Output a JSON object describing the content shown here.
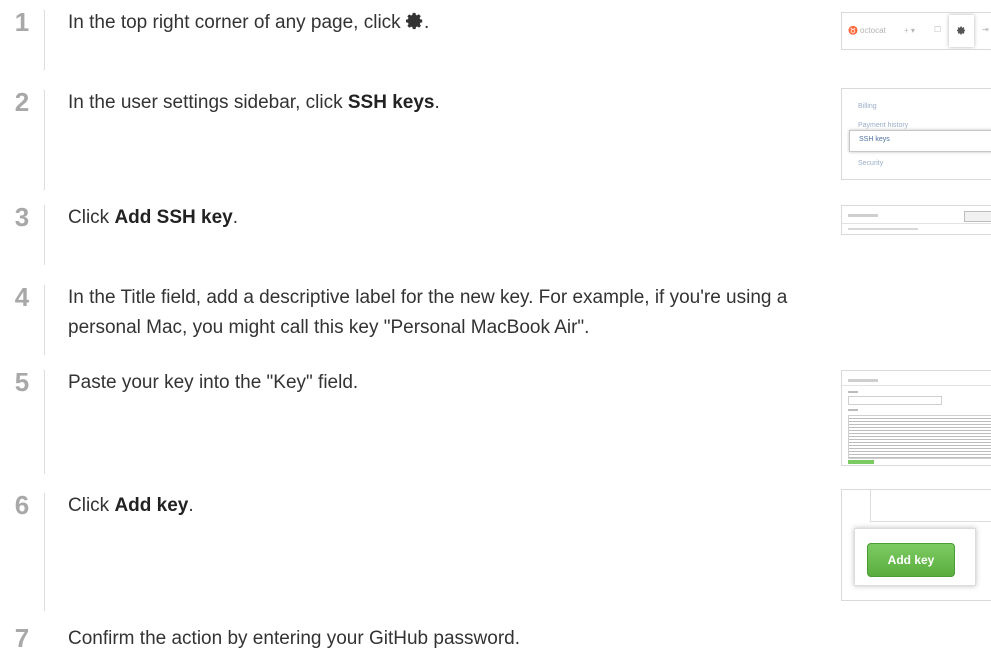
{
  "steps": [
    {
      "number": "1",
      "text_before": "In the top right corner of any page, click ",
      "bold": "",
      "text_after": "."
    },
    {
      "number": "2",
      "text_before": "In the user settings sidebar, click ",
      "bold": "SSH keys",
      "text_after": "."
    },
    {
      "number": "3",
      "text_before": "Click ",
      "bold": "Add SSH key",
      "text_after": "."
    },
    {
      "number": "4",
      "line1": "In the Title field, add a descriptive label for the new key. For example, if you're using a",
      "line2": "personal Mac, you might call this key \"Personal MacBook Air\"."
    },
    {
      "number": "5",
      "text_before": "Paste your key into the \"Key\" field.",
      "bold": "",
      "text_after": ""
    },
    {
      "number": "6",
      "text_before": "Click ",
      "bold": "Add key",
      "text_after": "."
    },
    {
      "number": "7",
      "text_before": "Confirm the action by entering your GitHub password.",
      "bold": "",
      "text_after": ""
    }
  ],
  "thumbnails": {
    "header": {
      "username": "octocat",
      "plus": "+ ▾"
    },
    "sidebar": {
      "items": [
        "Billing",
        "Payment history",
        "SSH keys",
        "Security"
      ]
    },
    "add_key_button": "Add key"
  },
  "colors": {
    "step_number": "#a8a8a8",
    "button_green": "#5aad3f",
    "link_blue": "#4e6f9e"
  },
  "icons": {
    "settings": "gear-icon"
  }
}
